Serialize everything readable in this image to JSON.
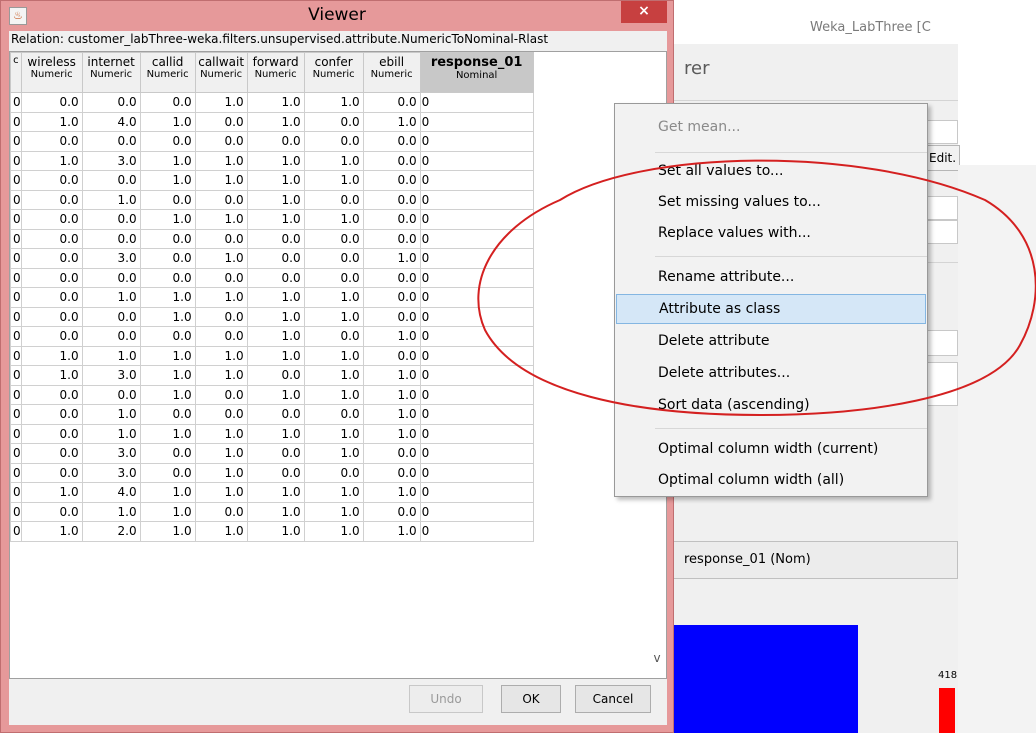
{
  "background_window": {
    "title": "Weka_LabThree [C",
    "heading": "rer",
    "edit_label": "Edit.",
    "attribute_label": "response_01 (Nom)",
    "bar_count_label": "418",
    "colors": {
      "blue_bar": "#0000ff",
      "red_bar": "#ff0000"
    }
  },
  "viewer": {
    "title": "Viewer",
    "close_label": "×",
    "relation": "Relation: customer_labThree-weka.filters.unsupervised.attribute.NumericToNominal-Rlast",
    "columns": [
      {
        "name": "",
        "type": "c"
      },
      {
        "name": "wireless",
        "type": "Numeric"
      },
      {
        "name": "internet",
        "type": "Numeric"
      },
      {
        "name": "callid",
        "type": "Numeric"
      },
      {
        "name": "callwait",
        "type": "Numeric"
      },
      {
        "name": "forward",
        "type": "Numeric"
      },
      {
        "name": "confer",
        "type": "Numeric"
      },
      {
        "name": "ebill",
        "type": "Numeric"
      },
      {
        "name": "response_01",
        "type": "Nominal"
      }
    ],
    "rows": [
      [
        "0",
        "0.0",
        "0.0",
        "0.0",
        "1.0",
        "1.0",
        "1.0",
        "0.0",
        "0"
      ],
      [
        "0",
        "1.0",
        "4.0",
        "1.0",
        "0.0",
        "1.0",
        "0.0",
        "1.0",
        "0"
      ],
      [
        "0",
        "0.0",
        "0.0",
        "0.0",
        "0.0",
        "0.0",
        "0.0",
        "0.0",
        "0"
      ],
      [
        "0",
        "1.0",
        "3.0",
        "1.0",
        "1.0",
        "1.0",
        "1.0",
        "0.0",
        "0"
      ],
      [
        "0",
        "0.0",
        "0.0",
        "1.0",
        "1.0",
        "1.0",
        "1.0",
        "0.0",
        "0"
      ],
      [
        "0",
        "0.0",
        "1.0",
        "0.0",
        "0.0",
        "1.0",
        "0.0",
        "0.0",
        "0"
      ],
      [
        "0",
        "0.0",
        "0.0",
        "1.0",
        "1.0",
        "1.0",
        "1.0",
        "0.0",
        "0"
      ],
      [
        "0",
        "0.0",
        "0.0",
        "0.0",
        "0.0",
        "0.0",
        "0.0",
        "0.0",
        "0"
      ],
      [
        "0",
        "0.0",
        "3.0",
        "0.0",
        "1.0",
        "0.0",
        "0.0",
        "1.0",
        "0"
      ],
      [
        "0",
        "0.0",
        "0.0",
        "0.0",
        "0.0",
        "0.0",
        "0.0",
        "0.0",
        "0"
      ],
      [
        "0",
        "0.0",
        "1.0",
        "1.0",
        "1.0",
        "1.0",
        "1.0",
        "0.0",
        "0"
      ],
      [
        "0",
        "0.0",
        "0.0",
        "1.0",
        "0.0",
        "1.0",
        "1.0",
        "0.0",
        "0"
      ],
      [
        "0",
        "0.0",
        "0.0",
        "0.0",
        "0.0",
        "1.0",
        "0.0",
        "1.0",
        "0"
      ],
      [
        "0",
        "1.0",
        "1.0",
        "1.0",
        "1.0",
        "1.0",
        "1.0",
        "0.0",
        "0"
      ],
      [
        "0",
        "1.0",
        "3.0",
        "1.0",
        "1.0",
        "0.0",
        "1.0",
        "1.0",
        "0"
      ],
      [
        "0",
        "0.0",
        "0.0",
        "1.0",
        "0.0",
        "1.0",
        "1.0",
        "1.0",
        "0"
      ],
      [
        "0",
        "0.0",
        "1.0",
        "0.0",
        "0.0",
        "0.0",
        "0.0",
        "1.0",
        "0"
      ],
      [
        "0",
        "0.0",
        "1.0",
        "1.0",
        "1.0",
        "1.0",
        "1.0",
        "1.0",
        "0"
      ],
      [
        "0",
        "0.0",
        "3.0",
        "0.0",
        "1.0",
        "0.0",
        "1.0",
        "0.0",
        "0"
      ],
      [
        "0",
        "0.0",
        "3.0",
        "0.0",
        "1.0",
        "0.0",
        "0.0",
        "0.0",
        "0"
      ],
      [
        "0",
        "1.0",
        "4.0",
        "1.0",
        "1.0",
        "1.0",
        "1.0",
        "1.0",
        "0"
      ],
      [
        "0",
        "0.0",
        "1.0",
        "1.0",
        "0.0",
        "1.0",
        "1.0",
        "0.0",
        "0"
      ],
      [
        "0",
        "1.0",
        "2.0",
        "1.0",
        "1.0",
        "1.0",
        "1.0",
        "1.0",
        "0"
      ]
    ],
    "scroll": {
      "left_arrow": "<",
      "right_arrow": ">",
      "down_arrow": "v"
    },
    "buttons": {
      "undo": "Undo",
      "ok": "OK",
      "cancel": "Cancel"
    }
  },
  "context_menu": {
    "items": [
      {
        "label": "Get mean...",
        "enabled": false
      },
      {
        "label": "Set all values to...",
        "enabled": true
      },
      {
        "label": "Set missing values to...",
        "enabled": true
      },
      {
        "label": "Replace values with...",
        "enabled": true
      },
      {
        "label": "Rename attribute...",
        "enabled": true
      },
      {
        "label": "Attribute as class",
        "enabled": true,
        "highlighted": true
      },
      {
        "label": "Delete attribute",
        "enabled": true
      },
      {
        "label": "Delete attributes...",
        "enabled": true
      },
      {
        "label": "Sort data (ascending)",
        "enabled": true
      },
      {
        "label": "Optimal column width (current)",
        "enabled": true
      },
      {
        "label": "Optimal column width (all)",
        "enabled": true
      }
    ]
  },
  "annotation": {
    "color": "#d42020"
  }
}
